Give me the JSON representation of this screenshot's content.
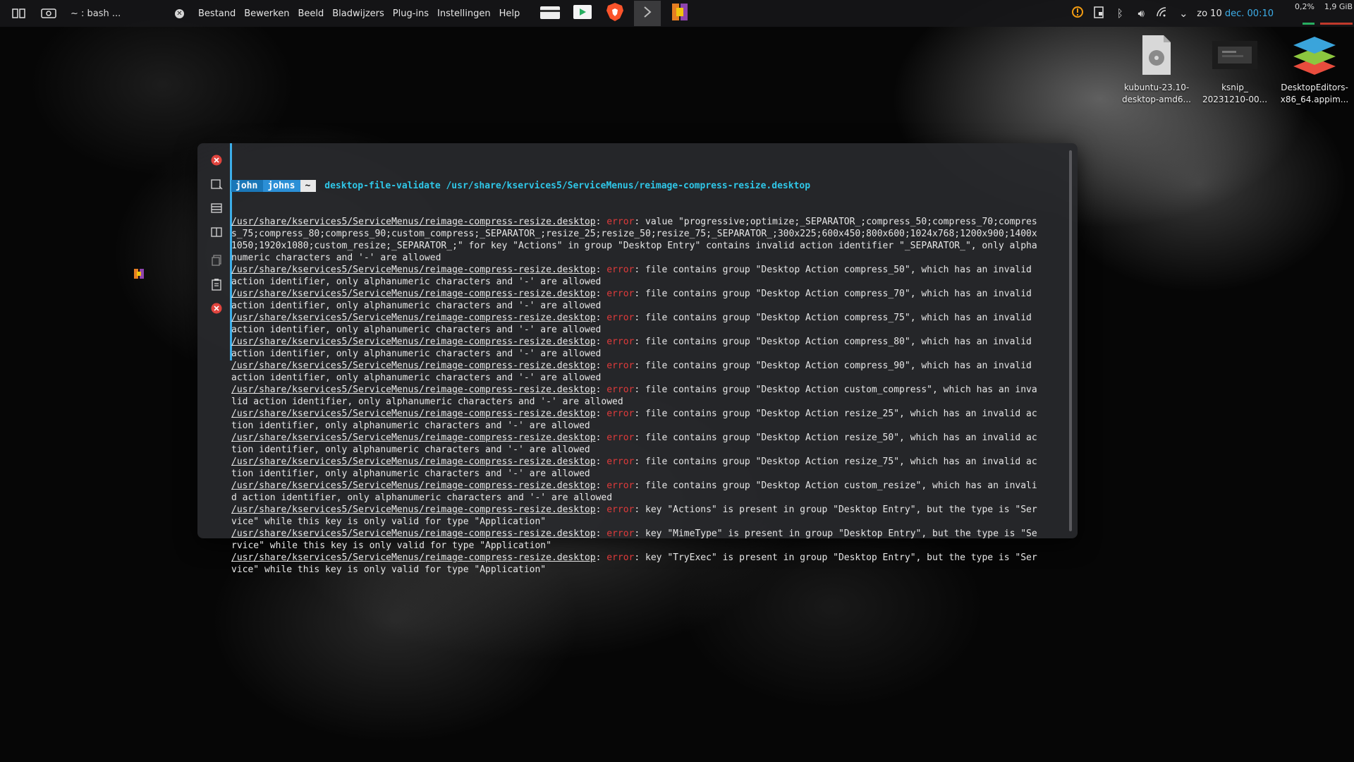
{
  "panel": {
    "window_title": "~ : bash ...",
    "menu": [
      "Bestand",
      "Bewerken",
      "Beeld",
      "Bladwijzers",
      "Plug-ins",
      "Instellingen",
      "Help"
    ],
    "clock": {
      "day": "zo",
      "date": "10",
      "month": "dec.",
      "time": "00:10"
    },
    "cpu": "0,2%",
    "memory": "1,9 GiB",
    "colors": {
      "accent": "#3daee9",
      "cpu_bar": "#27ae60",
      "mem_bar": "#c0392b"
    }
  },
  "desktop_icons": [
    {
      "label_line1": "kubuntu-23.10-",
      "label_line2": "desktop-amd6...",
      "icon": "iso-disk-icon"
    },
    {
      "label_line1": "ksnip_",
      "label_line2": "20231210-00...",
      "icon": "screenshot-thumbnail-icon"
    },
    {
      "label_line1": "DesktopEditors-",
      "label_line2": "x86_64.appim...",
      "icon": "onlyoffice-icon"
    }
  ],
  "terminal": {
    "prompt": {
      "user": "john",
      "host": "johns",
      "dir": "~"
    },
    "command": "desktop-file-validate /usr/share/kservices5/ServiceMenus/reimage-compress-resize.desktop",
    "error_word": "error",
    "path": "/usr/share/kservices5/ServiceMenus/reimage-compress-resize.desktop",
    "lines": [
      {
        "msg1": ": value \"progressive;optimize;_SEPARATOR_;compress_50;compress_70;compres",
        "rest": [
          "s_75;compress_80;compress_90;custom_compress;_SEPARATOR_;resize_25;resize_50;resize_75;_SEPARATOR_;300x225;600x450;800x600;1024x768;1200x900;1400x",
          "1050;1920x1080;custom_resize;_SEPARATOR_;\" for key \"Actions\" in group \"Desktop Entry\" contains invalid action identifier \"_SEPARATOR_\", only alpha",
          "numeric characters and '-' are allowed"
        ]
      },
      {
        "msg1": ": file contains group \"Desktop Action compress_50\", which has an invalid",
        "rest": [
          "action identifier, only alphanumeric characters and '-' are allowed"
        ]
      },
      {
        "msg1": ": file contains group \"Desktop Action compress_70\", which has an invalid",
        "rest": [
          "action identifier, only alphanumeric characters and '-' are allowed"
        ]
      },
      {
        "msg1": ": file contains group \"Desktop Action compress_75\", which has an invalid",
        "rest": [
          "action identifier, only alphanumeric characters and '-' are allowed"
        ]
      },
      {
        "msg1": ": file contains group \"Desktop Action compress_80\", which has an invalid",
        "rest": [
          "action identifier, only alphanumeric characters and '-' are allowed"
        ]
      },
      {
        "msg1": ": file contains group \"Desktop Action compress_90\", which has an invalid",
        "rest": [
          "action identifier, only alphanumeric characters and '-' are allowed"
        ]
      },
      {
        "msg1": ": file contains group \"Desktop Action custom_compress\", which has an inva",
        "rest": [
          "lid action identifier, only alphanumeric characters and '-' are allowed"
        ]
      },
      {
        "msg1": ": file contains group \"Desktop Action resize_25\", which has an invalid ac",
        "rest": [
          "tion identifier, only alphanumeric characters and '-' are allowed"
        ]
      },
      {
        "msg1": ": file contains group \"Desktop Action resize_50\", which has an invalid ac",
        "rest": [
          "tion identifier, only alphanumeric characters and '-' are allowed"
        ]
      },
      {
        "msg1": ": file contains group \"Desktop Action resize_75\", which has an invalid ac",
        "rest": [
          "tion identifier, only alphanumeric characters and '-' are allowed"
        ]
      },
      {
        "msg1": ": file contains group \"Desktop Action custom_resize\", which has an invali",
        "rest": [
          "d action identifier, only alphanumeric characters and '-' are allowed"
        ]
      },
      {
        "msg1": ": key \"Actions\" is present in group \"Desktop Entry\", but the type is \"Ser",
        "rest": [
          "vice\" while this key is only valid for type \"Application\""
        ]
      },
      {
        "msg1": ": key \"MimeType\" is present in group \"Desktop Entry\", but the type is \"Se",
        "rest": [
          "rvice\" while this key is only valid for type \"Application\""
        ]
      },
      {
        "msg1": ": key \"TryExec\" is present in group \"Desktop Entry\", but the type is \"Ser",
        "rest": [
          "vice\" while this key is only valid for type \"Application\""
        ]
      }
    ]
  }
}
